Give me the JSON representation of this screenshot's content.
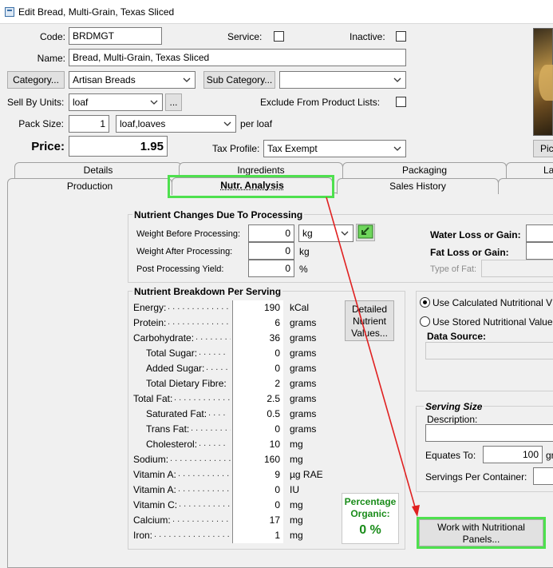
{
  "window": {
    "title": "Edit Bread, Multi-Grain, Texas Sliced"
  },
  "form": {
    "code_label": "Code:",
    "code_value": "BRDMGT",
    "service_label": "Service:",
    "inactive_label": "Inactive:",
    "name_label": "Name:",
    "name_value": "Bread, Multi-Grain, Texas Sliced",
    "category_button": "Category...",
    "category_value": "Artisan Breads",
    "subcategory_button": "Sub Category...",
    "subcategory_value": "",
    "sell_by_label": "Sell By Units:",
    "sell_by_value": "loaf",
    "sell_by_more": "...",
    "exclude_label": "Exclude From Product Lists:",
    "pack_size_label": "Pack Size:",
    "pack_size_value": "1",
    "pack_unit_value": "loaf,loaves",
    "per_label": "per loaf",
    "price_label": "Price:",
    "price_value": "1.95",
    "tax_label": "Tax Profile:",
    "tax_value": "Tax Exempt",
    "picture_button": "Pic"
  },
  "tabs_back": [
    "Details",
    "Ingredients",
    "Packaging",
    "La"
  ],
  "tabs_front": [
    "Production",
    "Nutr. Analysis",
    "Sales History"
  ],
  "processing": {
    "title": "Nutrient Changes Due To Processing",
    "weight_before_label": "Weight Before Processing:",
    "weight_before_value": "0",
    "weight_before_unit": "kg",
    "weight_after_label": "Weight After Processing:",
    "weight_after_value": "0",
    "weight_after_unit": "kg",
    "yield_label": "Post Processing Yield:",
    "yield_value": "0",
    "yield_unit": "%",
    "water_loss_label": "Water Loss or Gain:",
    "fat_loss_label": "Fat Loss or Gain:",
    "fat_type_label": "Type of Fat:"
  },
  "breakdown": {
    "title": "Nutrient Breakdown Per Serving",
    "rows": [
      {
        "label": "Energy:",
        "dots": ". . . . . . . . . . . . . . .",
        "value": "190",
        "unit": "kCal",
        "indent": false
      },
      {
        "label": "Protein:",
        "dots": ". . . . . . . . . . . . . .",
        "value": "6",
        "unit": "grams",
        "indent": false
      },
      {
        "label": "Carbohydrate:",
        "dots": ". . . . . . . . .",
        "value": "36",
        "unit": "grams",
        "indent": false
      },
      {
        "label": "Total Sugar:",
        "dots": ". . . . . .",
        "value": "0",
        "unit": "grams",
        "indent": true
      },
      {
        "label": "Added Sugar:",
        "dots": ". . . . .",
        "value": "0",
        "unit": "grams",
        "indent": true
      },
      {
        "label": "Total Dietary Fibre:",
        "dots": "",
        "value": "2",
        "unit": "grams",
        "indent": true
      },
      {
        "label": "Total Fat:",
        "dots": ". . . . . . . . . . . . .",
        "value": "2.5",
        "unit": "grams",
        "indent": false
      },
      {
        "label": "Saturated Fat:",
        "dots": ". . . .",
        "value": "0.5",
        "unit": "grams",
        "indent": true
      },
      {
        "label": "Trans Fat:",
        "dots": ". . . . . . . . .",
        "value": "0",
        "unit": "grams",
        "indent": true
      },
      {
        "label": "Cholesterol:",
        "dots": ". . . . . .",
        "value": "10",
        "unit": "mg",
        "indent": true
      },
      {
        "label": "Sodium:",
        "dots": ". . . . . . . . . . . . . . .",
        "value": "160",
        "unit": "mg",
        "indent": false
      },
      {
        "label": "Vitamin A:",
        "dots": ". . . . . . . . . . . . .",
        "value": "9",
        "unit": "µg RAE",
        "indent": false
      },
      {
        "label": "Vitamin A:",
        "dots": ". . . . . . . . . . . . .",
        "value": "0",
        "unit": "IU",
        "indent": false
      },
      {
        "label": "Vitamin C:",
        "dots": ". . . . . . . . . . . . .",
        "value": "0",
        "unit": "mg",
        "indent": false
      },
      {
        "label": "Calcium:",
        "dots": ". . . . . . . . . . . . . .",
        "value": "17",
        "unit": "mg",
        "indent": false
      },
      {
        "label": "Iron:",
        "dots": ". . . . . . . . . . . . . . . . .",
        "value": "1",
        "unit": "mg",
        "indent": false
      }
    ],
    "detailed_button": "Detailed Nutrient Values...",
    "organic_label": "Percentage Organic:",
    "organic_value": "0 %"
  },
  "source": {
    "use_calculated_label": "Use Calculated Nutritional V",
    "use_stored_label": "Use Stored Nutritional Value",
    "data_source_label": "Data Source:"
  },
  "serving": {
    "title": "Serving Size",
    "description_label": "Description:",
    "equates_label": "Equates To:",
    "equates_value": "100",
    "equates_unit": "gr",
    "servings_label": "Servings Per Container:"
  },
  "panels_button": "Work with Nutritional Panels...",
  "colors": {
    "highlight": "#4ee04e",
    "arrow": "#e02020",
    "organic_text": "#1a8c1a"
  }
}
